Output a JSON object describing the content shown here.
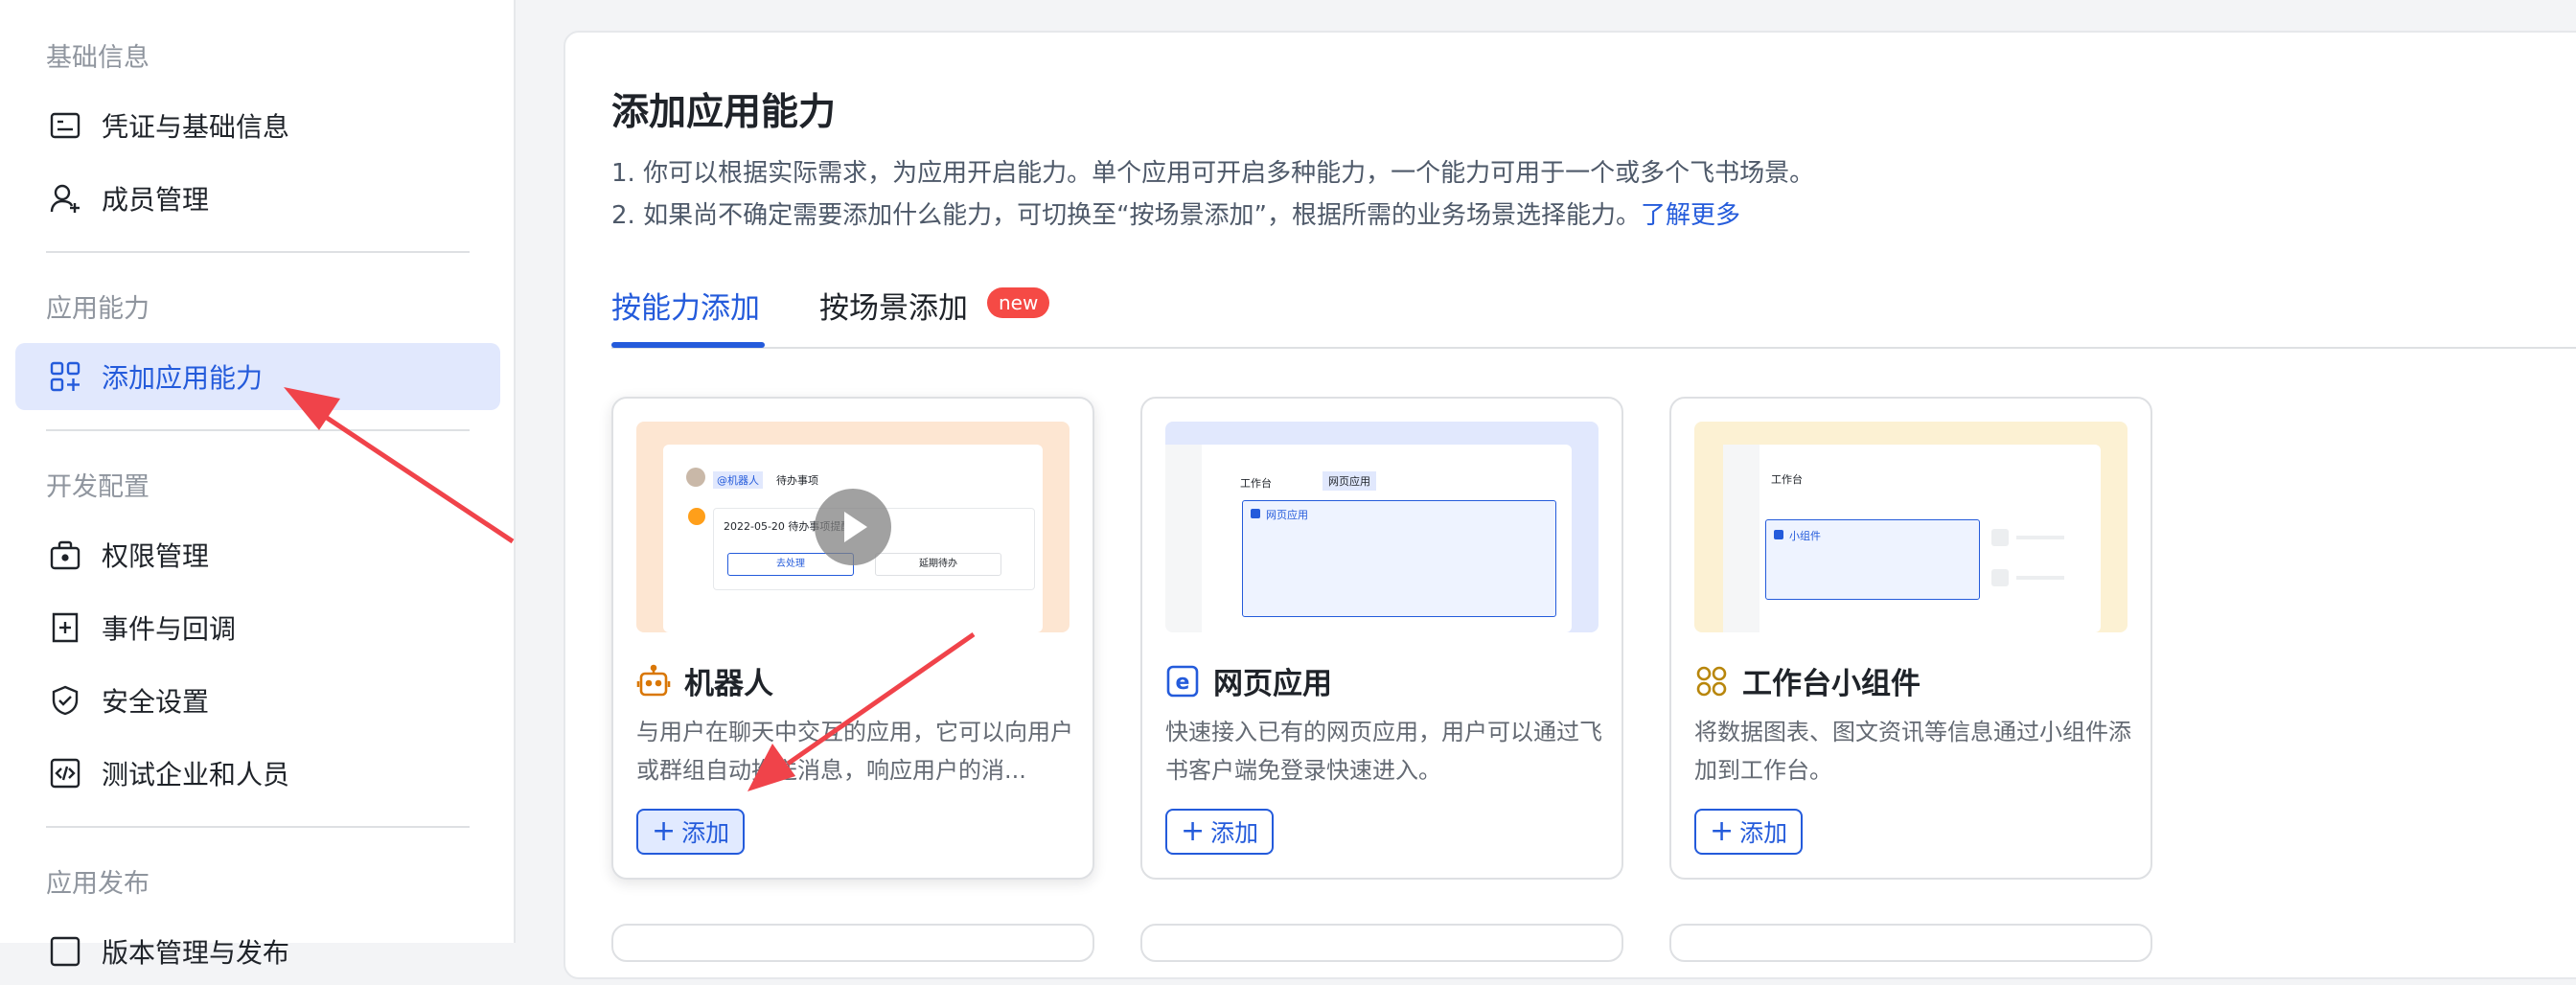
{
  "sidebar": {
    "sections": [
      {
        "title": "基础信息"
      },
      {
        "title": "应用能力"
      },
      {
        "title": "开发配置"
      },
      {
        "title": "应用发布"
      }
    ],
    "items": [
      {
        "label": "凭证与基础信息",
        "icon": "credential-icon"
      },
      {
        "label": "成员管理",
        "icon": "user-add-icon"
      },
      {
        "label": "添加应用能力",
        "icon": "app-add-icon"
      },
      {
        "label": "权限管理",
        "icon": "permission-icon"
      },
      {
        "label": "事件与回调",
        "icon": "event-icon"
      },
      {
        "label": "安全设置",
        "icon": "shield-icon"
      },
      {
        "label": "测试企业和人员",
        "icon": "code-icon"
      },
      {
        "label": "版本管理与发布",
        "icon": "version-icon"
      }
    ]
  },
  "main": {
    "title": "添加应用能力",
    "desc_line1": "1. 你可以根据实际需求，为应用开启能力。单个应用可开启多种能力，一个能力可用于一个或多个飞书场景。",
    "desc_line2": "2. 如果尚不确定需要添加什么能力，可切换至“按场景添加”，根据所需的业务场景选择能力。",
    "learn_more": "了解更多",
    "tabs": [
      {
        "label": "按能力添加",
        "active": true
      },
      {
        "label": "按场景添加",
        "badge": "new"
      }
    ],
    "cards": [
      {
        "title": "机器人",
        "icon": "robot-icon",
        "desc": "与用户在聊天中交互的应用，它可以向用户或群组自动推送消息，响应用户的消...",
        "add_label": "添加",
        "preview": {
          "mention": "@机器人",
          "todo": "待办事项",
          "date_text": "2022-05-20 待办事项提醒",
          "btn_primary": "去处理",
          "btn_secondary": "延期待办"
        }
      },
      {
        "title": "网页应用",
        "icon": "web-app-icon",
        "desc": "快速接入已有的网页应用，用户可以通过飞书客户端免登录快速进入。",
        "add_label": "添加",
        "preview": {
          "tab1": "工作台",
          "tab2": "网页应用",
          "label": "网页应用"
        }
      },
      {
        "title": "工作台小组件",
        "icon": "widget-icon",
        "desc": "将数据图表、图文资讯等信息通过小组件添加到工作台。",
        "add_label": "添加",
        "preview": {
          "tab1": "工作台",
          "label": "小组件"
        }
      }
    ]
  },
  "colors": {
    "accent": "#245bdb",
    "badge": "#f54a45",
    "arrow": "#f0434a"
  }
}
